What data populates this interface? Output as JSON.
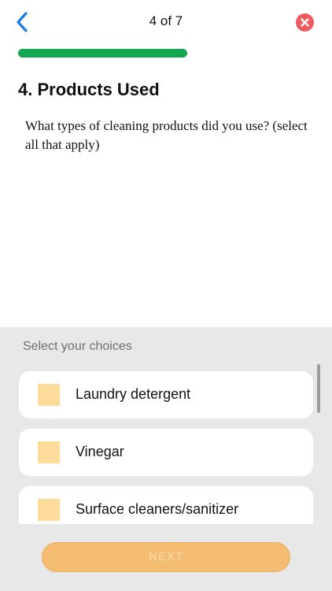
{
  "header": {
    "step_counter": "4 of 7",
    "back_icon": "chevron-left-icon",
    "close_icon": "close-icon",
    "accent_color": "#1a7ae6",
    "close_color": "#ef5a5f"
  },
  "progress": {
    "current_step": 4,
    "total_steps": 7,
    "fraction": 0.571,
    "fill_color": "#15a650"
  },
  "question": {
    "title": "4. Products Used",
    "text": "What types of cleaning products did you use? (select all that apply)"
  },
  "choices": {
    "heading": "Select your choices",
    "checkbox_color": "#fddc9b",
    "items": [
      {
        "label": "Laundry detergent",
        "checked": false
      },
      {
        "label": "Vinegar",
        "checked": false
      },
      {
        "label": "Surface cleaners/sanitizer",
        "checked": false
      }
    ]
  },
  "footer": {
    "next_label": "NEXT",
    "next_enabled": false,
    "button_color": "#f4bd72"
  }
}
